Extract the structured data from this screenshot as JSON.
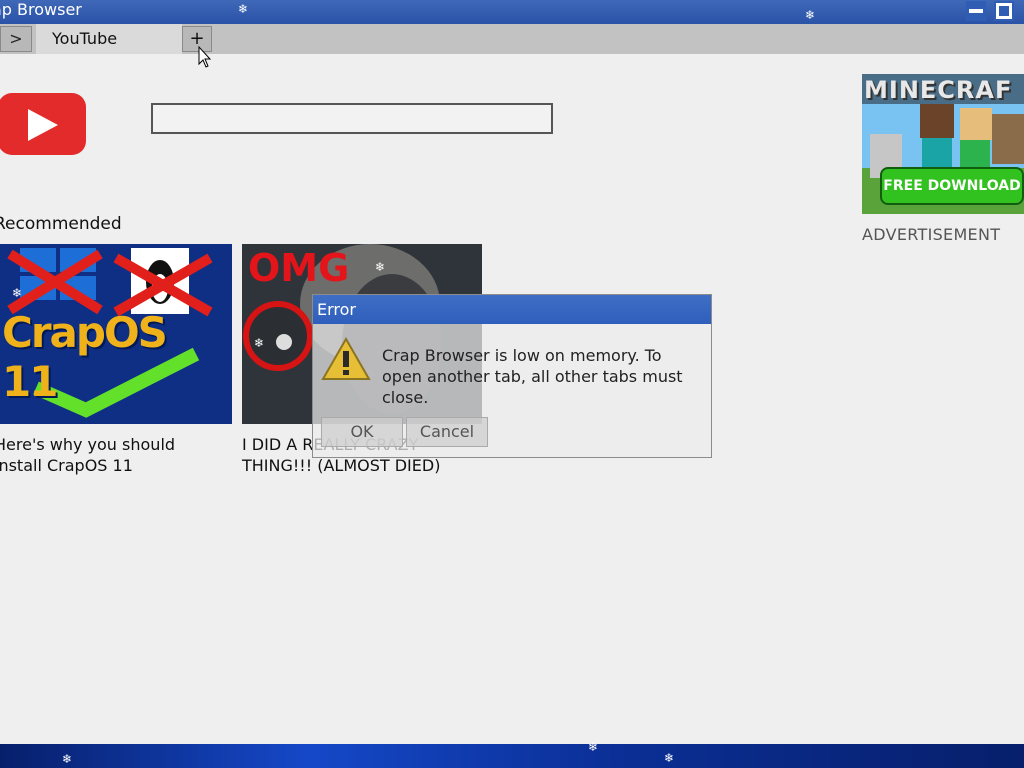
{
  "window": {
    "title": "ap Browser"
  },
  "tabs": {
    "back_label": ">",
    "active_label": "YouTube",
    "new_tab_label": "+"
  },
  "youtube": {
    "search_value": "",
    "search_placeholder": "",
    "section_label": "Recommended",
    "videos": [
      {
        "title": "Here's why you should install CrapOS 11",
        "thumb_text": "CrapOS 11"
      },
      {
        "title": "I DID A REALLY CRAZY THING!!! (ALMOST DIED)",
        "thumb_text": "OMG"
      }
    ]
  },
  "ad": {
    "brand": "MINECRAF",
    "cta": "FREE DOWNLOAD",
    "label": "ADVERTISEMENT"
  },
  "dialog": {
    "title": "Error",
    "message": "Crap Browser is low on memory. To open another tab, all other tabs must close.",
    "ok_label": "OK",
    "cancel_label": "Cancel"
  },
  "icons": {
    "window": [
      "minimize-icon",
      "maximize-icon"
    ],
    "dialog": "warning-icon",
    "logo": "youtube-play-icon",
    "cursor": "mouse-cursor-icon"
  },
  "colors": {
    "titlebar": "#2a53a8",
    "youtube_red": "#e32b2b",
    "dialog_title": "#3a68c2",
    "ad_button": "#31c21f"
  }
}
